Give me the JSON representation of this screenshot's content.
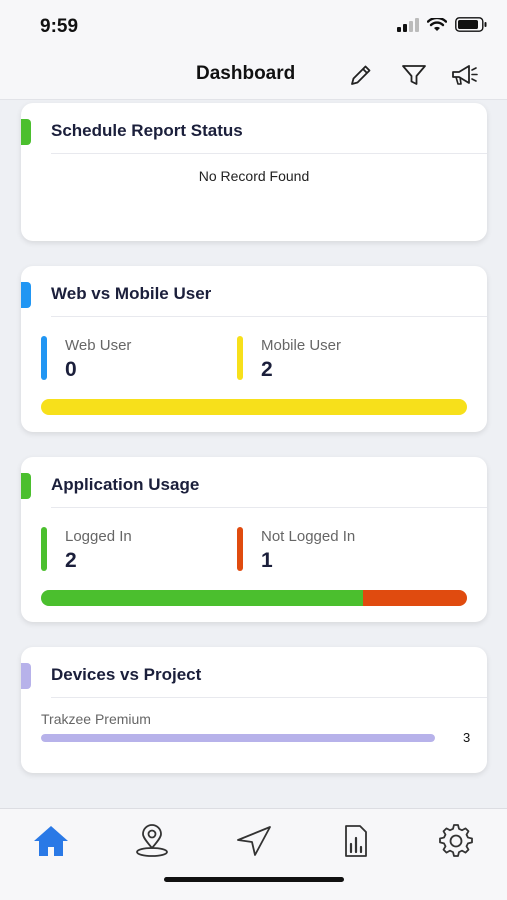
{
  "status_bar": {
    "time": "9:59"
  },
  "header": {
    "title": "Dashboard"
  },
  "colors": {
    "green": "#4bbf2e",
    "blue": "#2196f3",
    "yellow": "#f7e01b",
    "orange": "#e04b0f",
    "lavender": "#b7b2ea",
    "nav_active": "#2a79e6"
  },
  "cards": {
    "schedule_report": {
      "title": "Schedule Report Status",
      "empty_text": "No Record Found"
    },
    "web_vs_mobile": {
      "title": "Web vs Mobile User",
      "web_label": "Web User",
      "web_value": "0",
      "mobile_label": "Mobile User",
      "mobile_value": "2"
    },
    "application_usage": {
      "title": "Application Usage",
      "logged_in_label": "Logged In",
      "logged_in_value": "2",
      "not_logged_in_label": "Not Logged In",
      "not_logged_in_value": "1"
    },
    "devices_vs_project": {
      "title": "Devices vs Project",
      "projects": [
        {
          "name": "Trakzee Premium",
          "count": "3"
        }
      ]
    }
  },
  "bottom_nav": {
    "items": [
      {
        "icon": "home-icon",
        "active": true
      },
      {
        "icon": "location-pin-icon",
        "active": false
      },
      {
        "icon": "navigation-arrow-icon",
        "active": false
      },
      {
        "icon": "report-chart-icon",
        "active": false
      },
      {
        "icon": "settings-gear-icon",
        "active": false
      }
    ]
  }
}
